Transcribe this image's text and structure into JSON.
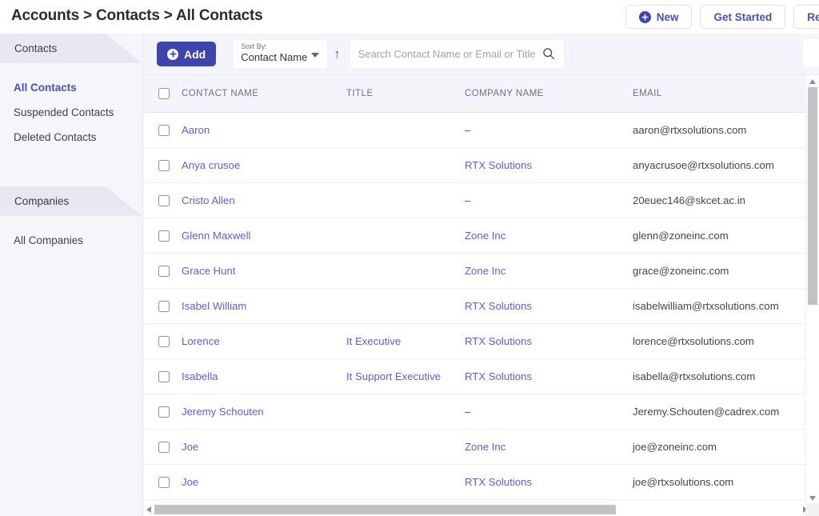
{
  "header": {
    "breadcrumb": "Accounts > Contacts > All Contacts",
    "buttons": [
      {
        "label": "New",
        "icon": "plus-circle-icon"
      },
      {
        "label": "Get Started",
        "icon": ""
      },
      {
        "label": "Requ",
        "icon": ""
      }
    ]
  },
  "sidebar": {
    "groups": [
      {
        "title": "Contacts",
        "items": [
          {
            "label": "All Contacts",
            "active": true
          },
          {
            "label": "Suspended Contacts",
            "active": false
          },
          {
            "label": "Deleted Contacts",
            "active": false
          }
        ]
      },
      {
        "title": "Companies",
        "items": [
          {
            "label": "All Companies",
            "active": false
          }
        ]
      }
    ]
  },
  "toolbar": {
    "add_label": "Add",
    "sort_label": "Sort By:",
    "sort_value": "Contact Name",
    "sort_direction": "↑",
    "search_placeholder": "Search Contact Name or Email or Title",
    "search_value": ""
  },
  "table": {
    "columns": [
      "CONTACT NAME",
      "TITLE",
      "COMPANY NAME",
      "EMAIL"
    ],
    "rows": [
      {
        "name": "Aaron",
        "title": "",
        "company": "–",
        "email": "aaron@rtxsolutions.com"
      },
      {
        "name": "Anya crusoe",
        "title": "",
        "company": "RTX Solutions",
        "email": "anyacrusoe@rtxsolutions.com"
      },
      {
        "name": "Cristo Allen",
        "title": "",
        "company": "–",
        "email": "20euec146@skcet.ac.in"
      },
      {
        "name": "Glenn Maxwell",
        "title": "",
        "company": "Zone Inc",
        "email": "glenn@zoneinc.com"
      },
      {
        "name": "Grace Hunt",
        "title": "",
        "company": "Zone Inc",
        "email": "grace@zoneinc.com"
      },
      {
        "name": "Isabel William",
        "title": "",
        "company": "RTX Solutions",
        "email": "isabelwilliam@rtxsolutions.com"
      },
      {
        "name": "Lorence",
        "title": "It Executive",
        "company": "RTX Solutions",
        "email": "lorence@rtxsolutions.com"
      },
      {
        "name": "Isabella",
        "title": "It Support Executive",
        "company": "RTX Solutions",
        "email": "isabella@rtxsolutions.com"
      },
      {
        "name": "Jeremy Schouten",
        "title": "",
        "company": "–",
        "email": "Jeremy.Schouten@cadrex.com"
      },
      {
        "name": "Joe",
        "title": "",
        "company": "Zone Inc",
        "email": "joe@zoneinc.com"
      },
      {
        "name": "Joe",
        "title": "",
        "company": "RTX Solutions",
        "email": "joe@rtxsolutions.com"
      }
    ]
  },
  "colors": {
    "primary": "#3f44ad",
    "link": "#5d62c4",
    "sidebar_bg": "#f5f6fa",
    "ribbon_bg": "#e7e8f1",
    "header_bg": "#f4f5fa"
  }
}
